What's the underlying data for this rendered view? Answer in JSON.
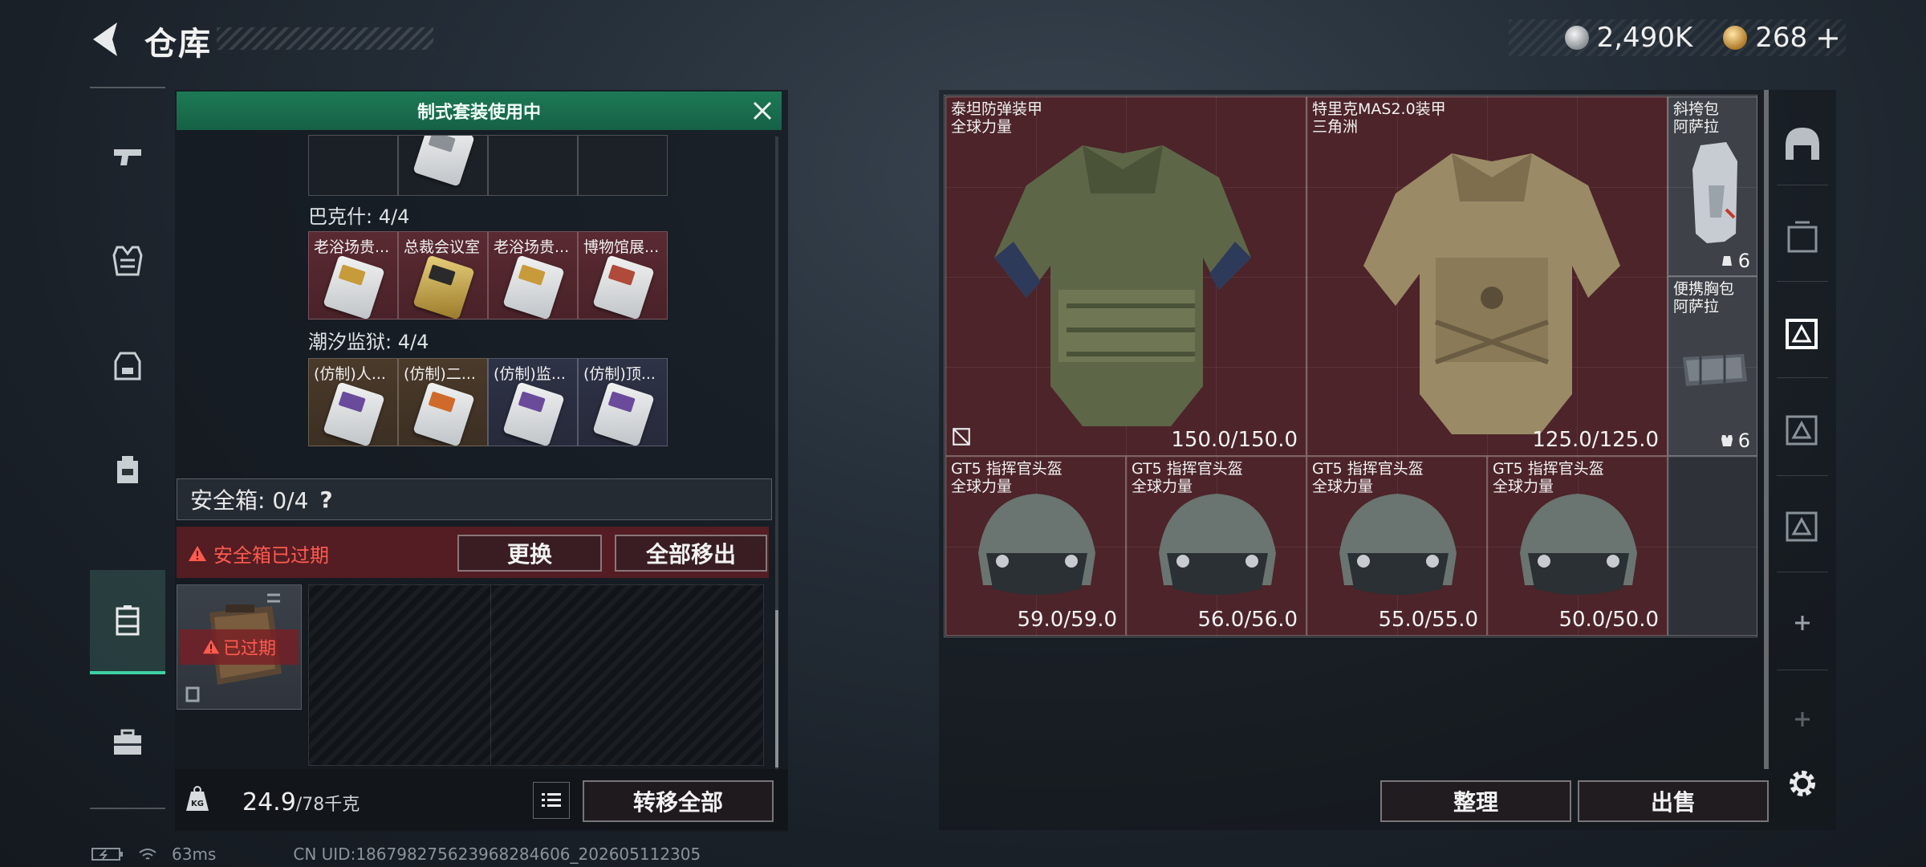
{
  "header": {
    "title": "仓库",
    "currency": [
      {
        "icon": "silver-coin-icon",
        "amount": "2,490K"
      },
      {
        "icon": "gold-coin-icon",
        "amount": "268",
        "plus": "+"
      }
    ]
  },
  "left_nav": {
    "items": [
      {
        "icon": "pistol-icon"
      },
      {
        "icon": "vest-icon"
      },
      {
        "icon": "backpack-rig-icon"
      },
      {
        "icon": "backpack-icon"
      },
      {
        "icon": "safebox-icon",
        "active": true
      },
      {
        "icon": "toolbox-icon"
      }
    ]
  },
  "loadout": {
    "banner": "制式套装使用中",
    "sets": [
      {
        "label": "巴克什: 4/4",
        "keys": [
          {
            "name": "老浴场贵...",
            "color": "red"
          },
          {
            "name": "总裁会议室",
            "color": "red"
          },
          {
            "name": "老浴场贵...",
            "color": "red"
          },
          {
            "name": "博物馆展...",
            "color": "red"
          }
        ]
      },
      {
        "label": "潮汐监狱: 4/4",
        "keys": [
          {
            "name": "(仿制)人...",
            "color": "brown"
          },
          {
            "name": "(仿制)二...",
            "color": "brown"
          },
          {
            "name": "(仿制)监...",
            "color": "blue"
          },
          {
            "name": "(仿制)顶...",
            "color": "blue"
          }
        ]
      }
    ],
    "safebox": {
      "label": "安全箱: 0/4",
      "help": "?",
      "expired_notice": "安全箱已过期",
      "replace_label": "更换",
      "move_all_label": "全部移出",
      "item_expired_tag": "已过期"
    },
    "weight": {
      "current": "24.9",
      "max": "/78千克"
    },
    "transfer_all_label": "转移全部"
  },
  "stash": {
    "items": [
      {
        "name": "泰坦防弹装甲",
        "sub": "全球力量",
        "durability": "150.0/150.0",
        "color": "red",
        "kind": "armor-olive"
      },
      {
        "name": "特里克MAS2.0装甲",
        "sub": "三角洲",
        "durability": "125.0/125.0",
        "color": "red",
        "kind": "armor-camo"
      },
      {
        "name": "斜挎包",
        "sub": "阿萨拉",
        "count": "6",
        "color": "grey",
        "kind": "sling-bag"
      },
      {
        "name": "便携胸包",
        "sub": "阿萨拉",
        "count": "6",
        "color": "grey",
        "kind": "chest-bag"
      },
      {
        "name": "GT5 指挥官头盔",
        "sub": "全球力量",
        "durability": "59.0/59.0",
        "color": "red",
        "kind": "helmet"
      },
      {
        "name": "GT5 指挥官头盔",
        "sub": "全球力量",
        "durability": "56.0/56.0",
        "color": "red",
        "kind": "helmet"
      },
      {
        "name": "GT5 指挥官头盔",
        "sub": "全球力量",
        "durability": "55.0/55.0",
        "color": "red",
        "kind": "helmet"
      },
      {
        "name": "GT5 指挥官头盔",
        "sub": "全球力量",
        "durability": "50.0/50.0",
        "color": "red",
        "kind": "helmet"
      }
    ],
    "sort_label": "整理",
    "sell_label": "出售"
  },
  "right_nav": {
    "items": [
      {
        "icon": "stash-home-icon"
      },
      {
        "icon": "stash-tab-icon"
      },
      {
        "icon": "stash-tab-active-icon"
      },
      {
        "icon": "stash-tab-icon"
      },
      {
        "icon": "stash-tab-icon"
      },
      {
        "icon": "add-icon"
      },
      {
        "icon": "add-icon"
      }
    ],
    "settings_icon": "gear-icon"
  },
  "status": {
    "ping": "63ms",
    "uid": "CN UID:1867982756239682846​06_202605112305"
  }
}
